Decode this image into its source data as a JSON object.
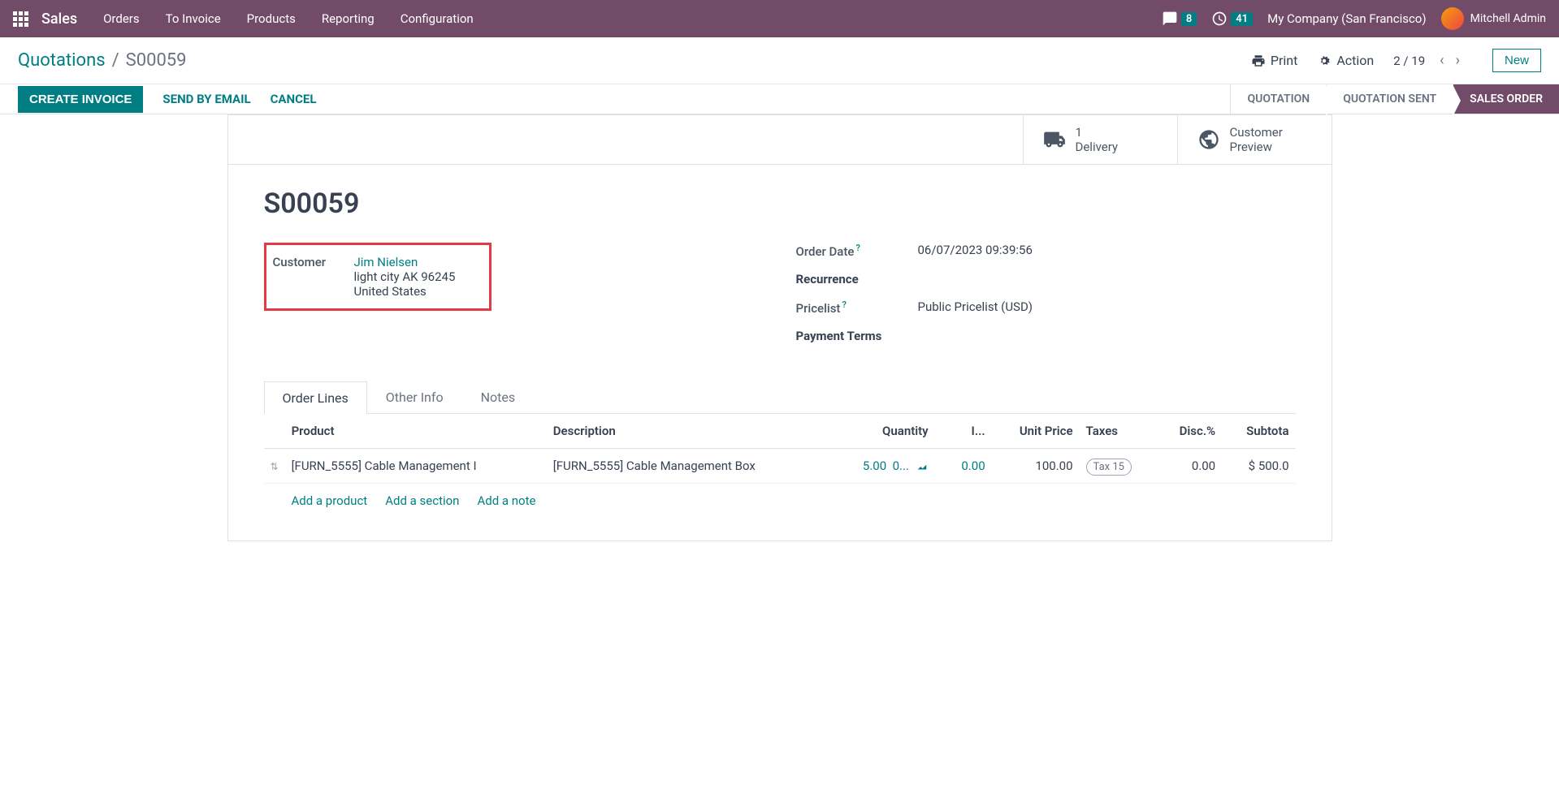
{
  "topbar": {
    "app_name": "Sales",
    "nav": [
      "Orders",
      "To Invoice",
      "Products",
      "Reporting",
      "Configuration"
    ],
    "messages_badge": "8",
    "activities_badge": "41",
    "company": "My Company (San Francisco)",
    "user": "Mitchell Admin"
  },
  "breadcrumb": {
    "root": "Quotations",
    "current": "S00059",
    "print": "Print",
    "action": "Action",
    "pager": "2 / 19",
    "new_btn": "New"
  },
  "actions": {
    "create_invoice": "CREATE INVOICE",
    "send_email": "SEND BY EMAIL",
    "cancel": "CANCEL"
  },
  "status": {
    "quotation": "QUOTATION",
    "quotation_sent": "QUOTATION SENT",
    "sales_order": "SALES ORDER"
  },
  "stats": {
    "delivery_count": "1",
    "delivery_label": "Delivery",
    "preview_line1": "Customer",
    "preview_line2": "Preview"
  },
  "record": {
    "title": "S00059",
    "customer_label": "Customer",
    "customer_name": "Jim Nielsen",
    "customer_addr1": "light city AK 96245",
    "customer_addr2": "United States",
    "order_date_label": "Order Date",
    "order_date": "06/07/2023 09:39:56",
    "recurrence_label": "Recurrence",
    "pricelist_label": "Pricelist",
    "pricelist": "Public Pricelist (USD)",
    "payment_terms_label": "Payment Terms"
  },
  "tabs": {
    "order_lines": "Order Lines",
    "other_info": "Other Info",
    "notes": "Notes"
  },
  "table": {
    "headers": {
      "product": "Product",
      "description": "Description",
      "quantity": "Quantity",
      "i": "I...",
      "unit_price": "Unit Price",
      "taxes": "Taxes",
      "disc": "Disc.%",
      "subtotal": "Subtota"
    },
    "row": {
      "product": "[FURN_5555] Cable Management I",
      "description": "[FURN_5555] Cable Management Box",
      "quantity": "5.00",
      "qty_extra": "0...",
      "i_val": "0.00",
      "unit_price": "100.00",
      "tax": "Tax 15",
      "disc": "0.00",
      "subtotal": "$ 500.0"
    },
    "add_product": "Add a product",
    "add_section": "Add a section",
    "add_note": "Add a note"
  }
}
